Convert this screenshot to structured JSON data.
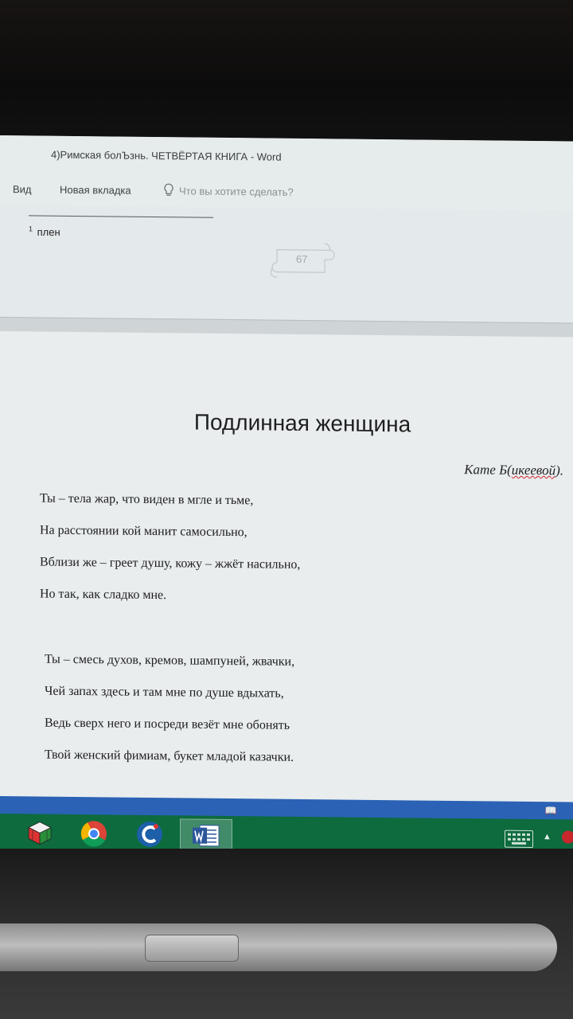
{
  "window": {
    "title": "4)Римская болЪзнь. ЧЕТВЁРТАЯ КНИГА  -  Word"
  },
  "ribbon": {
    "tabs": [
      "Вид",
      "Новая вкладка"
    ],
    "tell_me": "Что вы хотите сделать?"
  },
  "previous_page": {
    "footnote_number": "1",
    "footnote_text": "плен",
    "page_number": "67"
  },
  "document": {
    "title": "Подлинная женщина",
    "dedication_prefix": "Кате Б(",
    "dedication_misspelled": "икеевой",
    "dedication_suffix": ").",
    "stanzas": [
      [
        "Ты – тела жар, что виден в мгле и тьме,",
        "На расстоянии кой манит самосильно,",
        "Вблизи же – греет душу, кожу – жжёт насильно,",
        "Но так, как сладко мне."
      ],
      [
        "Ты – смесь духов, кремов, шампуней, жвачки,",
        "Чей запах здесь и там мне по душе вдыхать,",
        "Ведь сверх него и посреди везёт мне обонять",
        "Твой женский фимиам, букет младой казачки."
      ]
    ]
  },
  "taskbar": {
    "apps": [
      "rubiks-cube-icon",
      "chrome-icon",
      "ccleaner-icon",
      "word-icon"
    ],
    "colors": {
      "taskbar": "#0d6b3e",
      "statusbar": "#2b62b5"
    }
  }
}
